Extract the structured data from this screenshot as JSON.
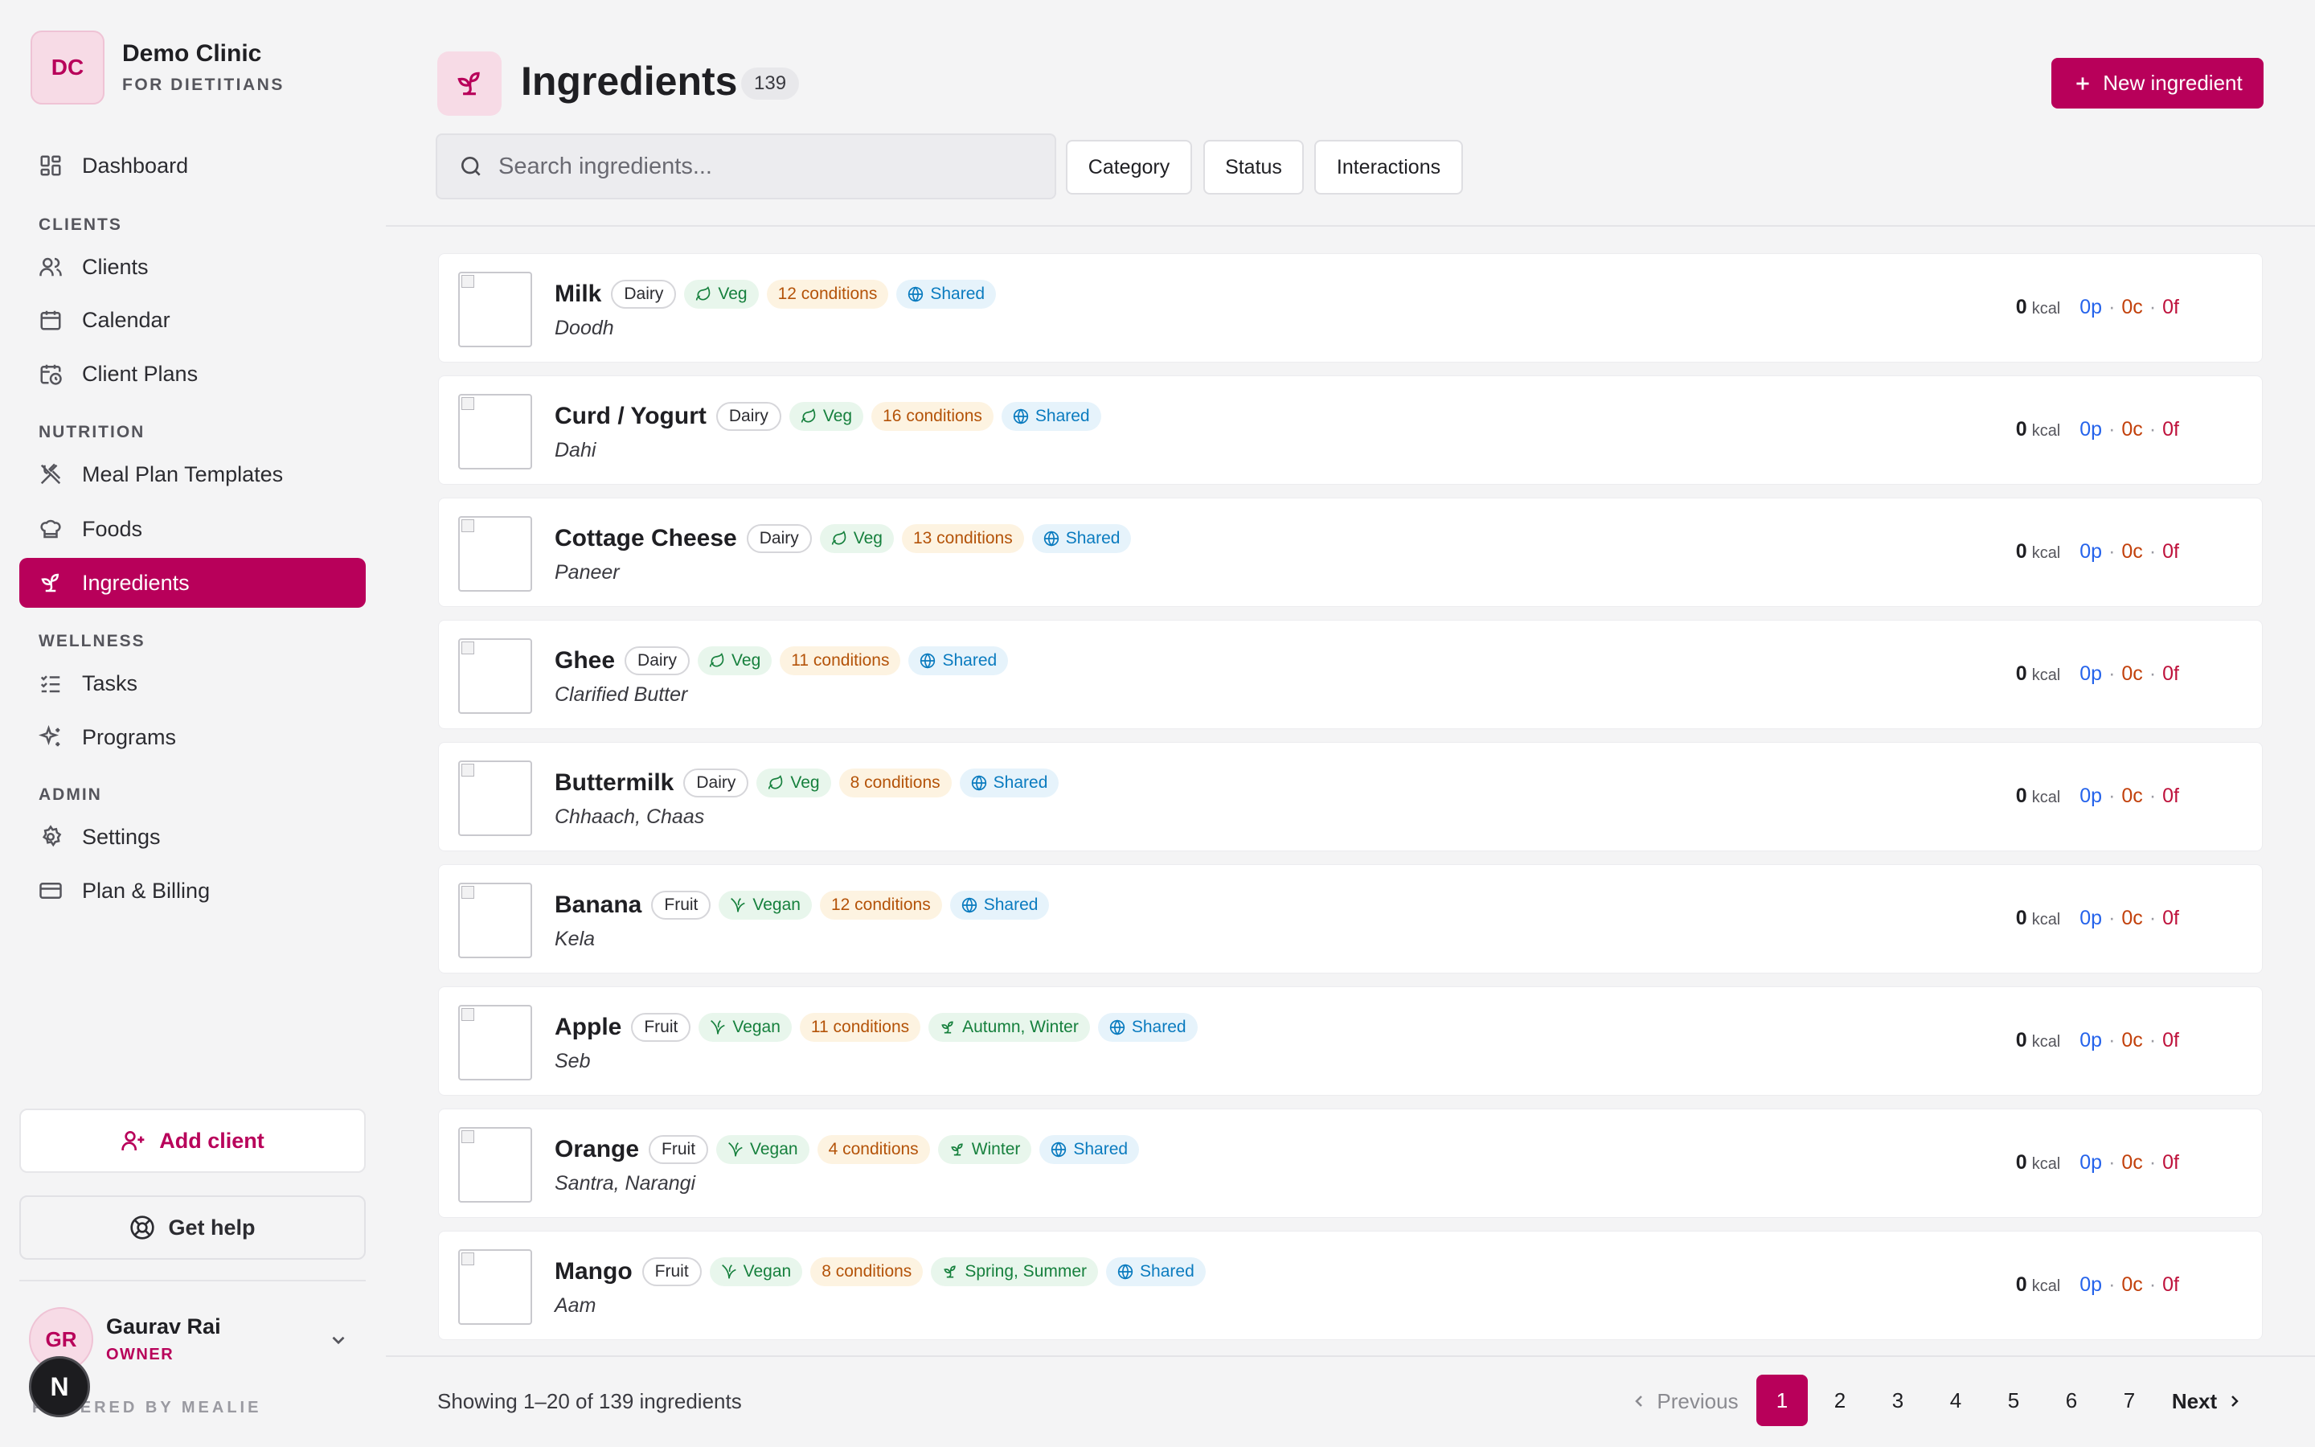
{
  "brand": {
    "initials": "DC",
    "name": "Demo Clinic",
    "subtitle": "FOR DIETITIANS"
  },
  "nav": {
    "dashboard": "Dashboard",
    "section_clients": "CLIENTS",
    "clients": "Clients",
    "calendar": "Calendar",
    "client_plans": "Client Plans",
    "section_nutrition": "NUTRITION",
    "meal_plan_templates": "Meal Plan Templates",
    "foods": "Foods",
    "ingredients": "Ingredients",
    "section_wellness": "WELLNESS",
    "tasks": "Tasks",
    "programs": "Programs",
    "section_admin": "ADMIN",
    "settings": "Settings",
    "plan_billing": "Plan & Billing",
    "active": "ingredients"
  },
  "sidebar_actions": {
    "add_client": "Add client",
    "get_help": "Get help"
  },
  "user": {
    "initials": "GR",
    "name": "Gaurav Rai",
    "role": "OWNER"
  },
  "powered_by": "POWERED BY MEALIE",
  "dev_badge": "N",
  "header": {
    "title": "Ingredients",
    "count": "139",
    "new_button": "New ingredient",
    "search_placeholder": "Search ingredients...",
    "filters": {
      "category": "Category",
      "status": "Status",
      "interactions": "Interactions"
    }
  },
  "ingredients": [
    {
      "name": "Milk",
      "category": "Dairy",
      "diet": "Veg",
      "conditions": "12 conditions",
      "season": "",
      "shared": "Shared",
      "alt_names": "Doodh",
      "kcal": "0",
      "unit": "kcal",
      "protein": "0p",
      "carbs": "0c",
      "fat": "0f"
    },
    {
      "name": "Curd / Yogurt",
      "category": "Dairy",
      "diet": "Veg",
      "conditions": "16 conditions",
      "season": "",
      "shared": "Shared",
      "alt_names": "Dahi",
      "kcal": "0",
      "unit": "kcal",
      "protein": "0p",
      "carbs": "0c",
      "fat": "0f"
    },
    {
      "name": "Cottage Cheese",
      "category": "Dairy",
      "diet": "Veg",
      "conditions": "13 conditions",
      "season": "",
      "shared": "Shared",
      "alt_names": "Paneer",
      "kcal": "0",
      "unit": "kcal",
      "protein": "0p",
      "carbs": "0c",
      "fat": "0f"
    },
    {
      "name": "Ghee",
      "category": "Dairy",
      "diet": "Veg",
      "conditions": "11 conditions",
      "season": "",
      "shared": "Shared",
      "alt_names": "Clarified Butter",
      "kcal": "0",
      "unit": "kcal",
      "protein": "0p",
      "carbs": "0c",
      "fat": "0f"
    },
    {
      "name": "Buttermilk",
      "category": "Dairy",
      "diet": "Veg",
      "conditions": "8 conditions",
      "season": "",
      "shared": "Shared",
      "alt_names": "Chhaach, Chaas",
      "kcal": "0",
      "unit": "kcal",
      "protein": "0p",
      "carbs": "0c",
      "fat": "0f"
    },
    {
      "name": "Banana",
      "category": "Fruit",
      "diet": "Vegan",
      "conditions": "12 conditions",
      "season": "",
      "shared": "Shared",
      "alt_names": "Kela",
      "kcal": "0",
      "unit": "kcal",
      "protein": "0p",
      "carbs": "0c",
      "fat": "0f"
    },
    {
      "name": "Apple",
      "category": "Fruit",
      "diet": "Vegan",
      "conditions": "11 conditions",
      "season": "Autumn, Winter",
      "shared": "Shared",
      "alt_names": "Seb",
      "kcal": "0",
      "unit": "kcal",
      "protein": "0p",
      "carbs": "0c",
      "fat": "0f"
    },
    {
      "name": "Orange",
      "category": "Fruit",
      "diet": "Vegan",
      "conditions": "4 conditions",
      "season": "Winter",
      "shared": "Shared",
      "alt_names": "Santra, Narangi",
      "kcal": "0",
      "unit": "kcal",
      "protein": "0p",
      "carbs": "0c",
      "fat": "0f"
    },
    {
      "name": "Mango",
      "category": "Fruit",
      "diet": "Vegan",
      "conditions": "8 conditions",
      "season": "Spring, Summer",
      "shared": "Shared",
      "alt_names": "Aam",
      "kcal": "0",
      "unit": "kcal",
      "protein": "0p",
      "carbs": "0c",
      "fat": "0f"
    }
  ],
  "footer": {
    "showing": "Showing 1–20 of 139 ingredients",
    "previous": "Previous",
    "next": "Next",
    "pages": [
      "1",
      "2",
      "3",
      "4",
      "5",
      "6",
      "7"
    ],
    "current_page": "1"
  },
  "colors": {
    "accent": "#b8005a",
    "protein": "#2563eb",
    "carbs": "#c2410c",
    "fat": "#be123c",
    "veg_green": "#16803d",
    "conditions_orange": "#b45309",
    "shared_blue": "#0a7bbf"
  },
  "icons": {
    "dashboard": "layout-grid-icon",
    "clients": "users-icon",
    "calendar": "calendar-icon",
    "client_plans": "calendar-clock-icon",
    "meal_plan_templates": "utensils-crossed-icon",
    "foods": "chef-hat-icon",
    "ingredients": "sprout-icon",
    "tasks": "list-checks-icon",
    "programs": "sparkles-icon",
    "settings": "gear-icon",
    "plan_billing": "credit-card-icon",
    "veg": "leaf-icon",
    "vegan": "vegan-icon",
    "season": "sprout-icon",
    "shared": "globe-icon"
  }
}
